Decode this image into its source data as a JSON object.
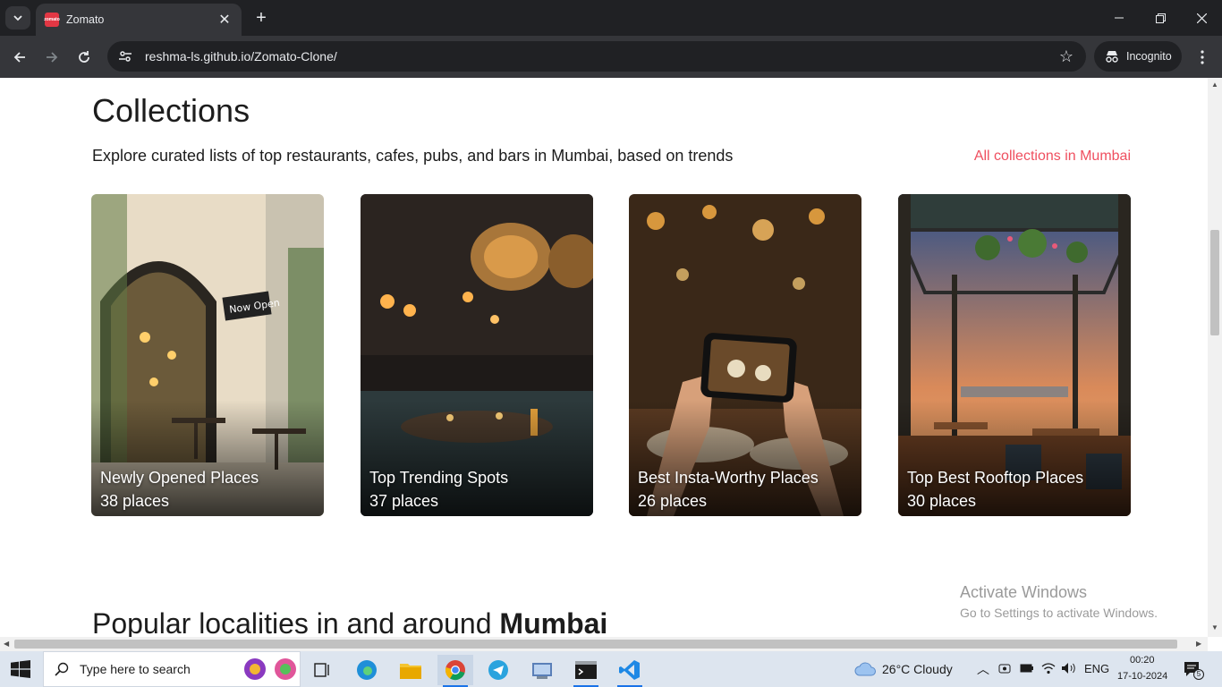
{
  "browser": {
    "tab_title": "Zomato",
    "favicon_text": "zomato",
    "url": "reshma-ls.github.io/Zomato-Clone/",
    "incognito_label": "Incognito"
  },
  "page": {
    "collections_title": "Collections",
    "collections_subtitle": "Explore curated lists of top restaurants, cafes, pubs, and bars in Mumbai, based on trends",
    "all_collections_link": "All collections in Mumbai",
    "cards": [
      {
        "title": "Newly Opened Places",
        "count": "38 places"
      },
      {
        "title": "Top Trending Spots",
        "count": "37 places"
      },
      {
        "title": "Best Insta-Worthy Places",
        "count": "26 places"
      },
      {
        "title": "Top Best Rooftop Places",
        "count": "30 places"
      }
    ],
    "localities_prefix": "Popular localities in and around ",
    "localities_city": "Mumbai"
  },
  "watermark": {
    "line1": "Activate Windows",
    "line2": "Go to Settings to activate Windows."
  },
  "taskbar": {
    "search_placeholder": "Type here to search",
    "weather": "26°C  Cloudy",
    "language": "ENG",
    "time": "00:20",
    "date": "17-10-2024",
    "notification_count": "5"
  },
  "colors": {
    "accent": "#ef4f5f",
    "brand": "#e23744"
  }
}
